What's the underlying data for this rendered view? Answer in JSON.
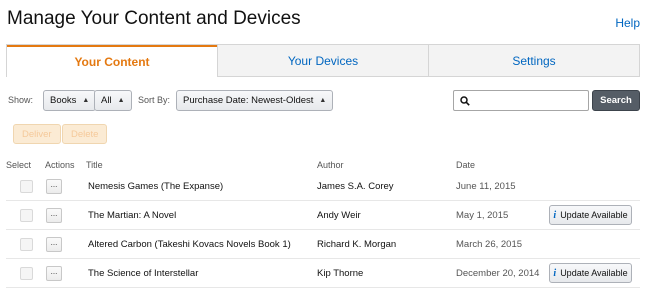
{
  "page": {
    "title": "Manage Your Content and Devices",
    "help": "Help"
  },
  "tabs": [
    "Your Content",
    "Your Devices",
    "Settings"
  ],
  "filters": {
    "show_label": "Show:",
    "type_value": "Books",
    "scope_value": "All",
    "sort_label": "Sort By:",
    "sort_value": "Purchase Date: Newest-Oldest",
    "search_placeholder": "",
    "search_button": "Search"
  },
  "bulk_actions": {
    "deliver": "Deliver",
    "delete": "Delete"
  },
  "table": {
    "headers": {
      "select": "Select",
      "actions": "Actions",
      "title": "Title",
      "author": "Author",
      "date": "Date"
    },
    "actions_glyph": "...",
    "update_label": "Update Available",
    "update_icon": "info-icon",
    "rows": [
      {
        "title": "Nemesis Games (The Expanse)",
        "author": "James S.A. Corey",
        "date": "June 11, 2015",
        "update": ""
      },
      {
        "title": "The Martian: A Novel",
        "author": "Andy Weir",
        "date": "May 1, 2015",
        "update": "Update Available"
      },
      {
        "title": "Altered Carbon (Takeshi Kovacs Novels Book 1)",
        "author": "Richard K. Morgan",
        "date": "March 26, 2015",
        "update": ""
      },
      {
        "title": "The Science of Interstellar",
        "author": "Kip Thorne",
        "date": "December 20, 2014",
        "update": "Update Available"
      }
    ]
  },
  "colors": {
    "accent": "#e47911",
    "link": "#0066c0",
    "search_button": "#555d66"
  }
}
